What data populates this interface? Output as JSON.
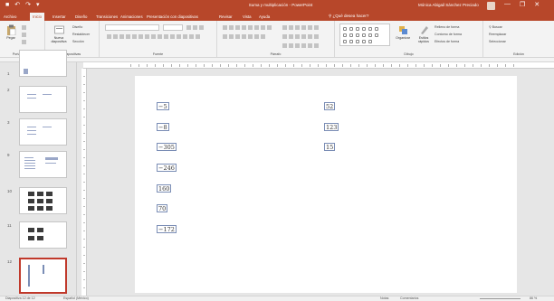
{
  "titlebar": {
    "title": "Suma y multiplicación - PowerPoint",
    "user": "Mónica Abigail Sánchez Preciado",
    "min": "—",
    "restore": "❐",
    "close": "✕",
    "qat": [
      "■",
      "↶",
      "↷",
      "▾"
    ]
  },
  "tabs": [
    {
      "label": "Archivo"
    },
    {
      "label": "Inicio",
      "active": true
    },
    {
      "label": "Insertar"
    },
    {
      "label": "Diseño"
    },
    {
      "label": "Transiciones"
    },
    {
      "label": "Animaciones"
    },
    {
      "label": "Presentación con diapositivas"
    },
    {
      "label": "Revisar"
    },
    {
      "label": "Vista"
    },
    {
      "label": "Ayuda"
    }
  ],
  "tellme": "¿Qué desea hacer?",
  "ribbon": {
    "groups": [
      {
        "label": "Portapapeles"
      },
      {
        "label": "Diapositivas"
      },
      {
        "label": "Fuente"
      },
      {
        "label": "Párrafo"
      },
      {
        "label": "Dibujo"
      },
      {
        "label": "Edición"
      }
    ],
    "paste": "Pegar",
    "new_slide": "Nueva diapositiva",
    "layout": "Diseño",
    "reset": "Restablecer",
    "section": "Sección",
    "arrange": "Organizar",
    "styles": "Estilos rápidos",
    "fill": "Relleno de forma",
    "outline": "Contorno de forma",
    "effects": "Efectos de forma",
    "find": "Buscar",
    "replace": "Reemplazar",
    "select": "Seleccionar",
    "font_name": "",
    "font_size": ""
  },
  "slides": [
    {
      "num": "1"
    },
    {
      "num": "2"
    },
    {
      "num": "3"
    },
    {
      "num": "9"
    },
    {
      "num": "10"
    },
    {
      "num": "11"
    },
    {
      "num": "12"
    }
  ],
  "slide_content": {
    "left_column": [
      "−5",
      "−8",
      "−305",
      "−246",
      "160",
      "70",
      "−172"
    ],
    "right_column": [
      "52",
      "123",
      "15"
    ]
  },
  "status": {
    "slide_info": "Diapositiva 12 de 12",
    "language": "Español (México)",
    "notes": "Notas",
    "comments": "Comentarios",
    "zoom": "86 %"
  },
  "colors": {
    "accent": "#b7472a",
    "selected_thumb": "#c0392b"
  }
}
